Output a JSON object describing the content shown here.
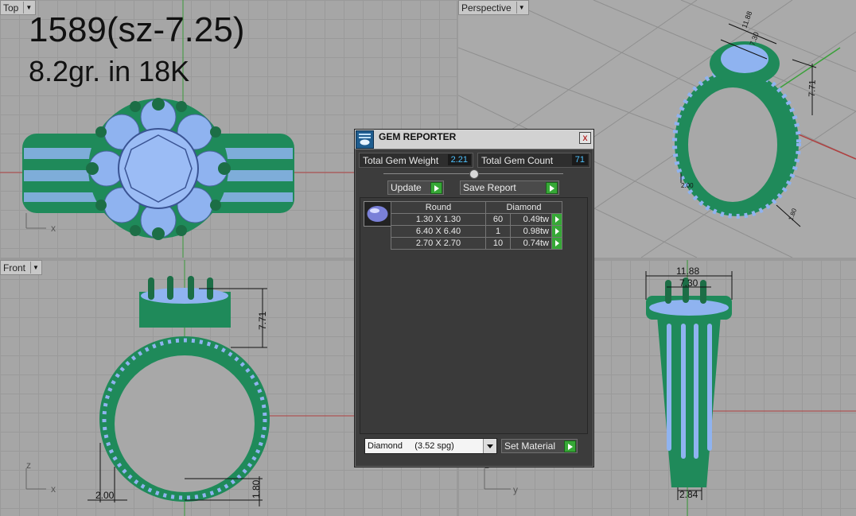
{
  "viewports": {
    "top": {
      "label": "Top",
      "axis_x": "x"
    },
    "perspective": {
      "label": "Perspective"
    },
    "front": {
      "label": "Front",
      "axis_z": "z",
      "axis_x": "x"
    },
    "right": {
      "axis_z": "z",
      "axis_y": "y"
    }
  },
  "annotation": {
    "title": "1589(sz-7.25)",
    "weight": "8.2gr.  in 18K"
  },
  "dimensions": {
    "front_height": "7.71",
    "front_width": "2.00",
    "front_bottom": "1.80",
    "right_outer": "11.88",
    "right_inner": "7.30",
    "right_bottom": "2.84",
    "persp_a": "11.88",
    "persp_b": "7.30",
    "persp_c": "7.71",
    "persp_d": "2.00",
    "persp_e": "1.80"
  },
  "gem_reporter": {
    "title": "GEM REPORTER",
    "close_label": "x",
    "total_weight_label": "Total Gem Weight",
    "total_weight_value": "2.21",
    "total_count_label": "Total Gem Count",
    "total_count_value": "71",
    "update_label": "Update",
    "save_report_label": "Save Report",
    "table": {
      "headers": [
        "Round",
        "Diamond"
      ],
      "rows": [
        {
          "size": "1.30 X 1.30",
          "count": "60",
          "weight": "0.49tw"
        },
        {
          "size": "6.40 X 6.40",
          "count": "1",
          "weight": "0.98tw"
        },
        {
          "size": "2.70 X 2.70",
          "count": "10",
          "weight": "0.74tw"
        }
      ]
    },
    "material_value": "Diamond     (3.52 spg)",
    "set_material_label": "Set Material"
  },
  "colors": {
    "metal": "#1f8a5a",
    "gem": "#8fb3f0",
    "panel": "#3c3c3c",
    "accent_green": "#36a836",
    "value_blue": "#4fc3ff"
  }
}
